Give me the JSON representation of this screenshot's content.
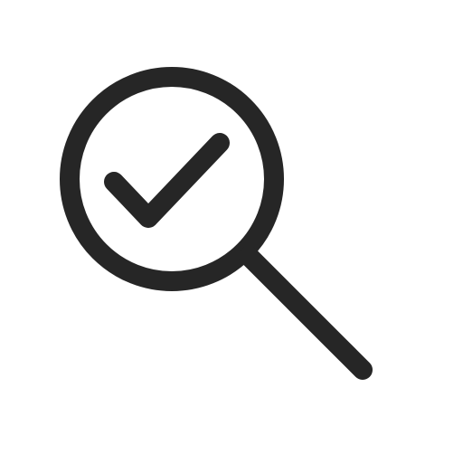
{
  "icon": {
    "name": "search-check-icon",
    "components": [
      "magnifier-lens-icon",
      "magnifier-handle-icon",
      "checkmark-icon"
    ],
    "color": "#262626",
    "background": "#ffffff"
  }
}
